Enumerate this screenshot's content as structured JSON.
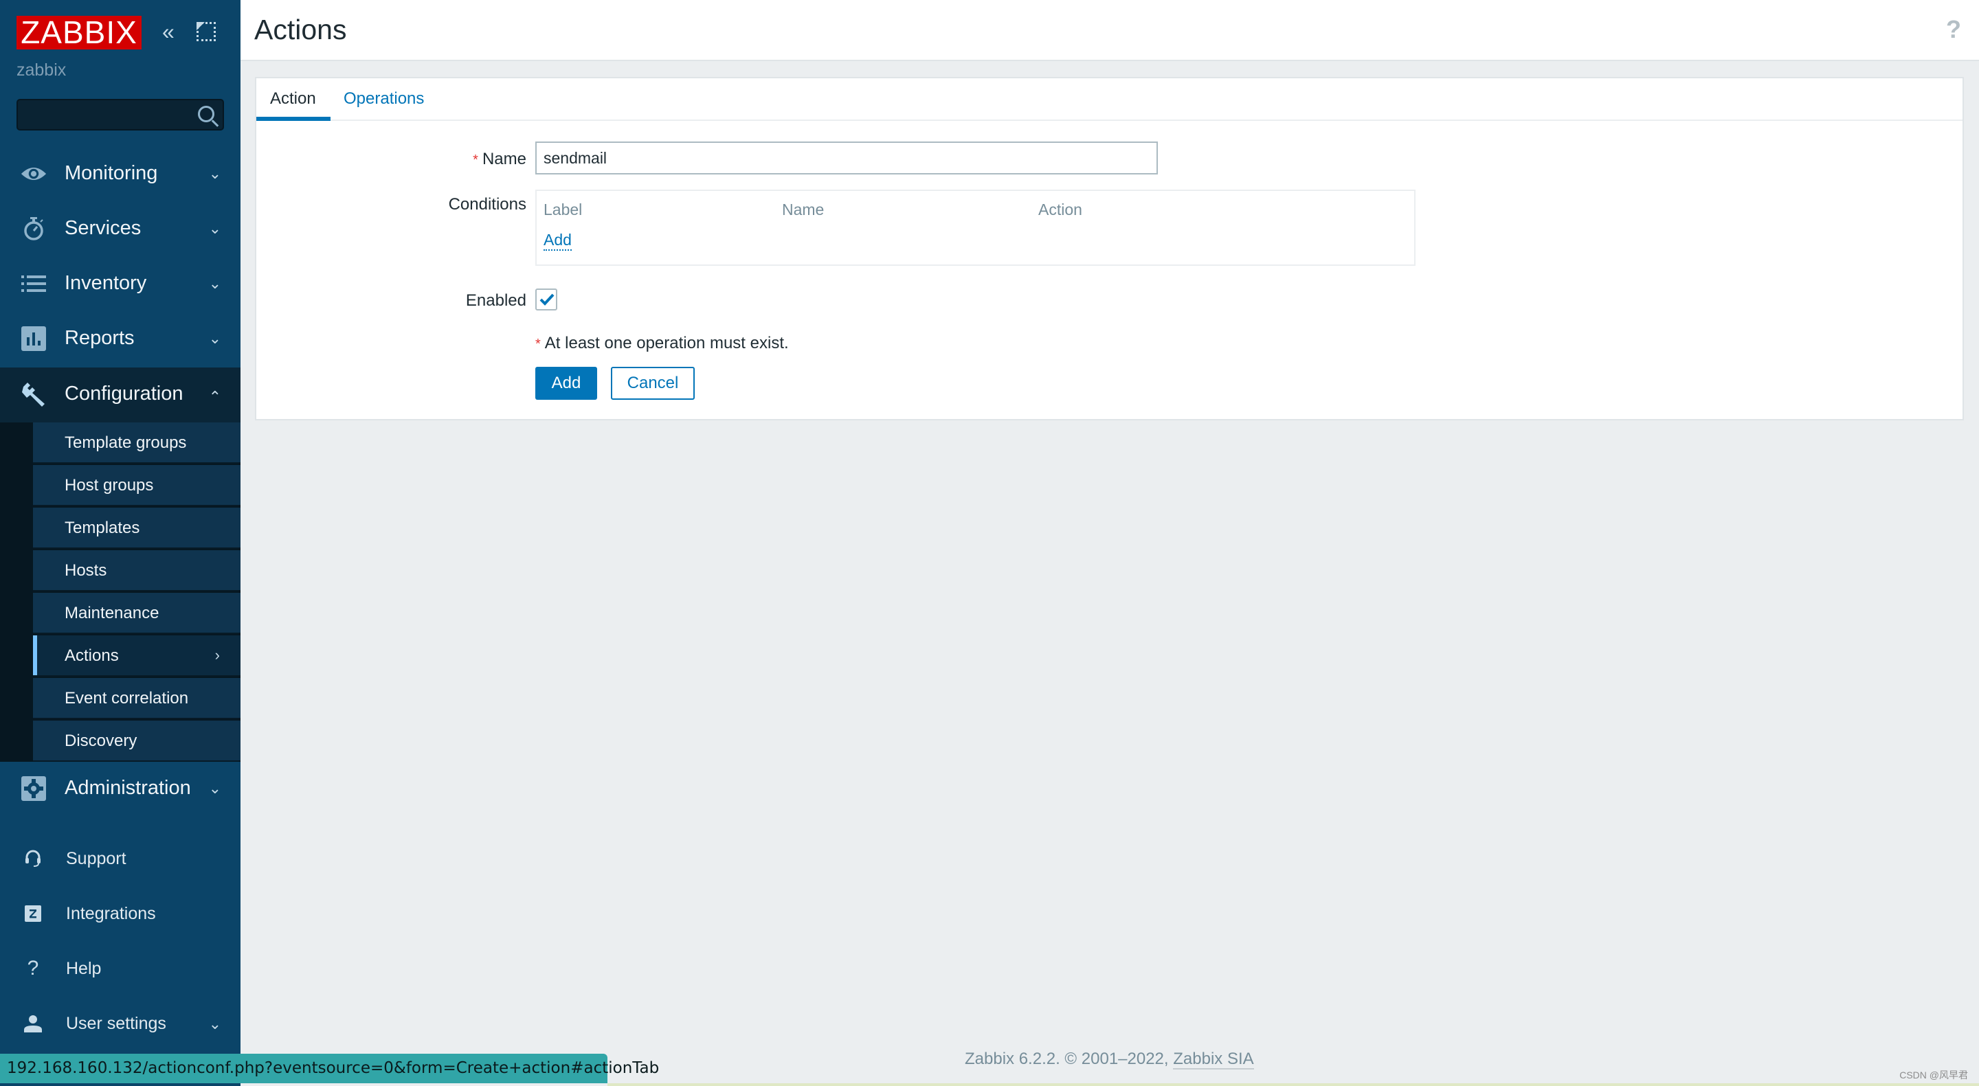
{
  "sidebar": {
    "logo": "ZABBIX",
    "server_name": "zabbix",
    "search": {
      "placeholder": "",
      "value": ""
    },
    "menu": [
      {
        "label": "Monitoring",
        "icon": "eye-icon",
        "expanded": false
      },
      {
        "label": "Services",
        "icon": "stopwatch-icon",
        "expanded": false
      },
      {
        "label": "Inventory",
        "icon": "list-icon",
        "expanded": false
      },
      {
        "label": "Reports",
        "icon": "bar-chart-icon",
        "expanded": false
      },
      {
        "label": "Configuration",
        "icon": "wrench-icon",
        "expanded": true
      },
      {
        "label": "Administration",
        "icon": "gear-icon",
        "expanded": false
      }
    ],
    "configuration_submenu": [
      {
        "label": "Template groups",
        "active": false
      },
      {
        "label": "Host groups",
        "active": false
      },
      {
        "label": "Templates",
        "active": false
      },
      {
        "label": "Hosts",
        "active": false
      },
      {
        "label": "Maintenance",
        "active": false
      },
      {
        "label": "Actions",
        "active": true
      },
      {
        "label": "Event correlation",
        "active": false
      },
      {
        "label": "Discovery",
        "active": false
      }
    ],
    "bottom": [
      {
        "label": "Support",
        "icon": "headset-icon"
      },
      {
        "label": "Integrations",
        "icon": "zabbix-z-icon"
      },
      {
        "label": "Help",
        "icon": "question-icon"
      },
      {
        "label": "User settings",
        "icon": "user-icon"
      }
    ]
  },
  "header": {
    "title": "Actions",
    "help": "?"
  },
  "tabs": [
    {
      "label": "Action",
      "active": true
    },
    {
      "label": "Operations",
      "active": false
    }
  ],
  "form": {
    "name_label": "Name",
    "name_required": "*",
    "name_value": "sendmail",
    "conditions_label": "Conditions",
    "conditions_columns": [
      "Label",
      "Name",
      "Action"
    ],
    "conditions_add": "Add",
    "enabled_label": "Enabled",
    "enabled_checked": true,
    "note_required": "*",
    "note": "At least one operation must exist.",
    "add_button": "Add",
    "cancel_button": "Cancel"
  },
  "footer": {
    "text": "Zabbix 6.2.2. © 2001–2022, ",
    "link": "Zabbix SIA"
  },
  "statusbar": {
    "url": "192.168.160.132/actionconf.php?eventsource=0&form=Create+action#actionTab"
  },
  "watermark": "CSDN @风早君",
  "colors": {
    "sidebar_bg": "#0b4468",
    "logo_red": "#d40000",
    "accent_blue": "#0275b8",
    "active_marker": "#79c4ff",
    "required_red": "#e33734"
  }
}
